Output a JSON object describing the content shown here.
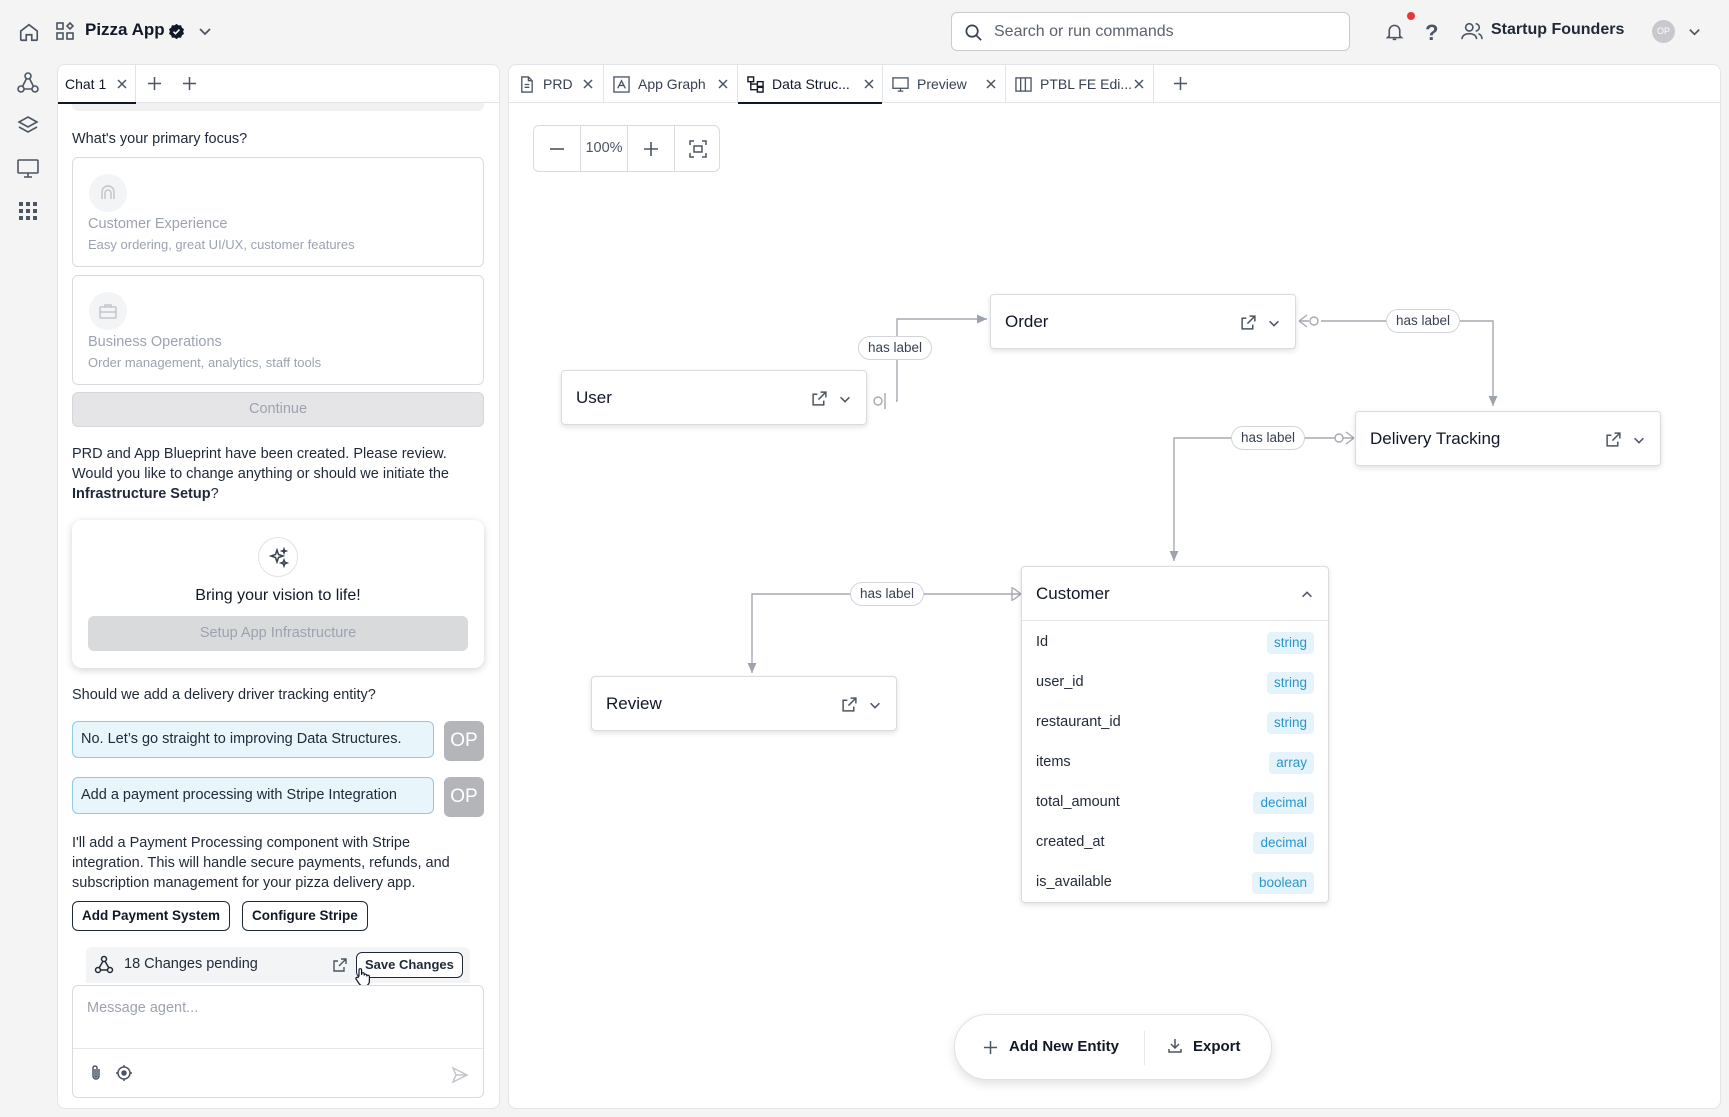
{
  "topbar": {
    "app_name": "Pizza App",
    "search_placeholder": "Search or run commands",
    "org_name": "Startup Founders",
    "avatar_initials": "OP",
    "help_glyph": "?"
  },
  "chat": {
    "tab_label": "Chat 1",
    "question": "What's your primary focus?",
    "options": [
      {
        "title": "Customer Experience",
        "desc": "Easy ordering, great UI/UX, customer features",
        "icon": "customer-icon"
      },
      {
        "title": "Business Operations",
        "desc": "Order management, analytics, staff tools",
        "icon": "briefcase-icon"
      }
    ],
    "continue_label": "Continue",
    "review_text": "PRD and App Blueprint have been created. Please review. Would you like to change anything or should we initiate the",
    "review_bold": "Infrastructure Setup",
    "review_end": "?",
    "vision_title": "Bring your vision to life!",
    "setup_label": "Setup App Infrastructure",
    "driver_question": "Should we add a delivery driver tracking entity?",
    "user_messages": [
      "No. Let’s go straight to improving Data Structures.",
      "Add a payment processing with Stripe Integration"
    ],
    "user_badge": "OP",
    "agent_reply": "I'll add a Payment Processing component with Stripe integration. This will handle secure payments, refunds, and subscription management for your pizza delivery app.",
    "actions": [
      "Add Payment System",
      "Configure Stripe"
    ],
    "pending_text": "18 Changes pending",
    "save_label": "Save Changes",
    "message_placeholder": "Message agent..."
  },
  "tabs": [
    {
      "label": "PRD",
      "icon": "document-icon"
    },
    {
      "label": "App Graph",
      "icon": "graph-icon"
    },
    {
      "label": "Data Struc...",
      "icon": "hierarchy-icon",
      "active": true
    },
    {
      "label": "Preview",
      "icon": "monitor-icon"
    },
    {
      "label": "PTBL FE Edi...",
      "icon": "layout-icon"
    }
  ],
  "canvas": {
    "zoom": "100%",
    "entities": {
      "user": "User",
      "order": "Order",
      "delivery": "Delivery Tracking",
      "customer": "Customer",
      "review": "Review"
    },
    "edge_label": "has label",
    "customer_fields": [
      {
        "name": "Id",
        "type": "string"
      },
      {
        "name": "user_id",
        "type": "string"
      },
      {
        "name": "restaurant_id",
        "type": "string"
      },
      {
        "name": "items",
        "type": "array"
      },
      {
        "name": "total_amount",
        "type": "decimal"
      },
      {
        "name": "created_at",
        "type": "decimal"
      },
      {
        "name": "is_available",
        "type": "boolean"
      }
    ],
    "add_entity_label": "Add New Entity",
    "export_label": "Export"
  }
}
